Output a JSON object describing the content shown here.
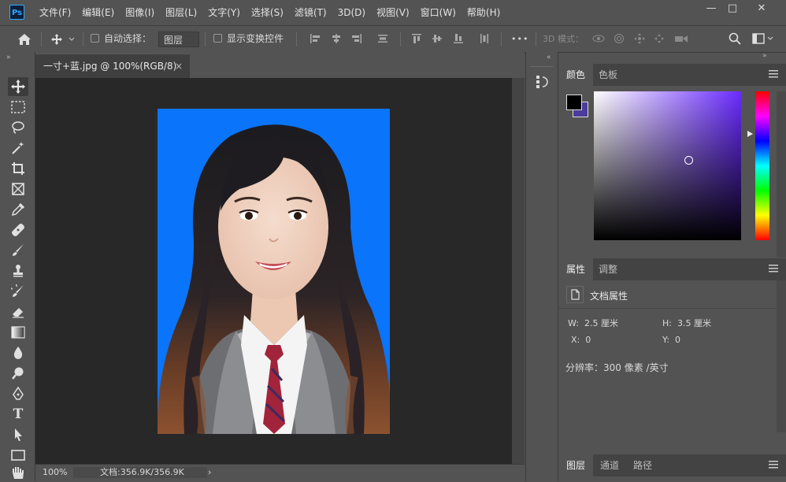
{
  "app": {
    "logo": "Ps"
  },
  "menu": [
    "文件(F)",
    "编辑(E)",
    "图像(I)",
    "图层(L)",
    "文字(Y)",
    "选择(S)",
    "滤镜(T)",
    "3D(D)",
    "视图(V)",
    "窗口(W)",
    "帮助(H)"
  ],
  "window_controls": {
    "minimize": "—",
    "maximize": "□",
    "close": "✕"
  },
  "options": {
    "auto_select_label": "自动选择：",
    "auto_select_value": "图层",
    "show_transform_label": "显示变换控件",
    "more": "•••",
    "mode_3d_label": "3D 模式："
  },
  "document": {
    "tab_title": "一寸+蓝.jpg @ 100%(RGB/8)",
    "tab_close": "×",
    "zoom": "100%",
    "doc_info": "文档:356.9K/356.9K",
    "status_arrow": "›",
    "photo_background": "#0a74fa"
  },
  "color_panel": {
    "tabs": [
      "颜色",
      "色板"
    ],
    "foreground": "#000000",
    "background": "#4a3b9c",
    "hue_color": "#6a2bff"
  },
  "properties_panel": {
    "tabs": [
      "属性",
      "调整"
    ],
    "section_title": "文档属性",
    "w_label": "W:",
    "w_value": "2.5 厘米",
    "h_label": "H:",
    "h_value": "3.5 厘米",
    "x_label": "X:",
    "x_value": "0",
    "y_label": "Y:",
    "y_value": "0",
    "resolution": "分辨率：300 像素 /英寸"
  },
  "layers_panel": {
    "tabs": [
      "图层",
      "通道",
      "路径"
    ]
  },
  "colors": {
    "app_bg": "#535353",
    "canvas_bg": "#282828",
    "accent": "#31a8ff"
  }
}
